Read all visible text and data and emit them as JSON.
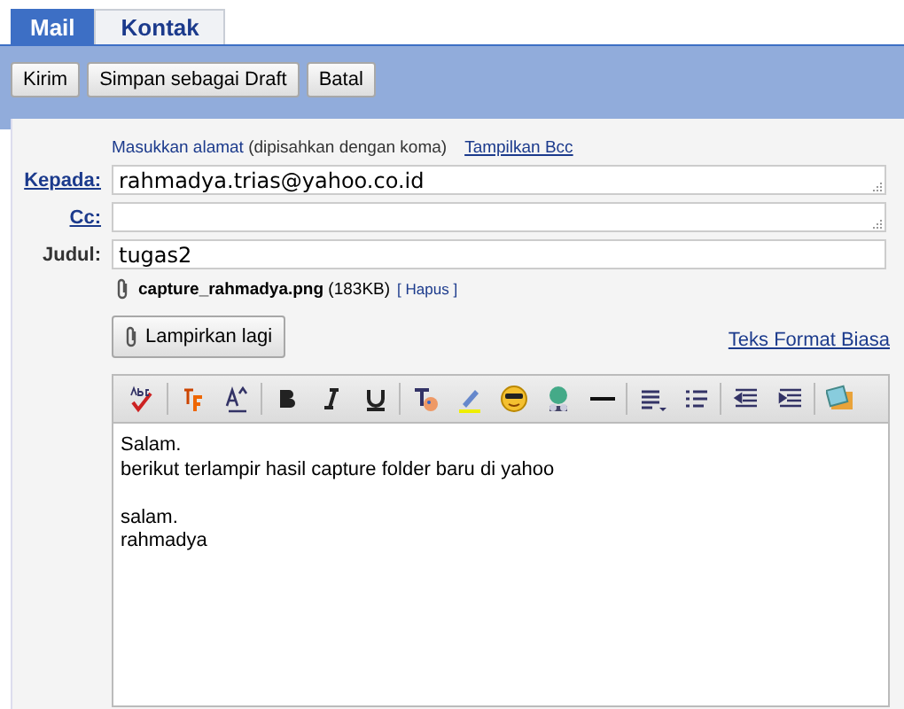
{
  "tabs": [
    {
      "label": "Mail",
      "selected": true
    },
    {
      "label": "Kontak",
      "selected": false
    }
  ],
  "actions": [
    "Kirim",
    "Simpan sebagai Draft",
    "Batal"
  ],
  "hint": {
    "text": "Masukkan alamat",
    "note": "(dipisahkan dengan koma)",
    "bcc_link": "Tampilkan Bcc"
  },
  "fields": [
    {
      "label": "Kepada:",
      "link": true,
      "value": "rahmadya.trias@yahoo.co.id",
      "resizable": true
    },
    {
      "label": "Cc:",
      "link": true,
      "resizable": true
    },
    {
      "label": "Judul:",
      "link": false,
      "value": "tugas2",
      "resizable": false
    }
  ],
  "attachment": {
    "name": "capture_rahmadya.png",
    "size": "(183KB)",
    "remove": "[ Hapus ]"
  },
  "attach_more": "Lampirkan lagi",
  "plain_text_link": "Teks Format Biasa",
  "body": [
    [
      "Salam.",
      "berikut terlampir hasil capture folder baru di yahoo"
    ],
    [
      "salam.",
      "rahmadya"
    ]
  ]
}
